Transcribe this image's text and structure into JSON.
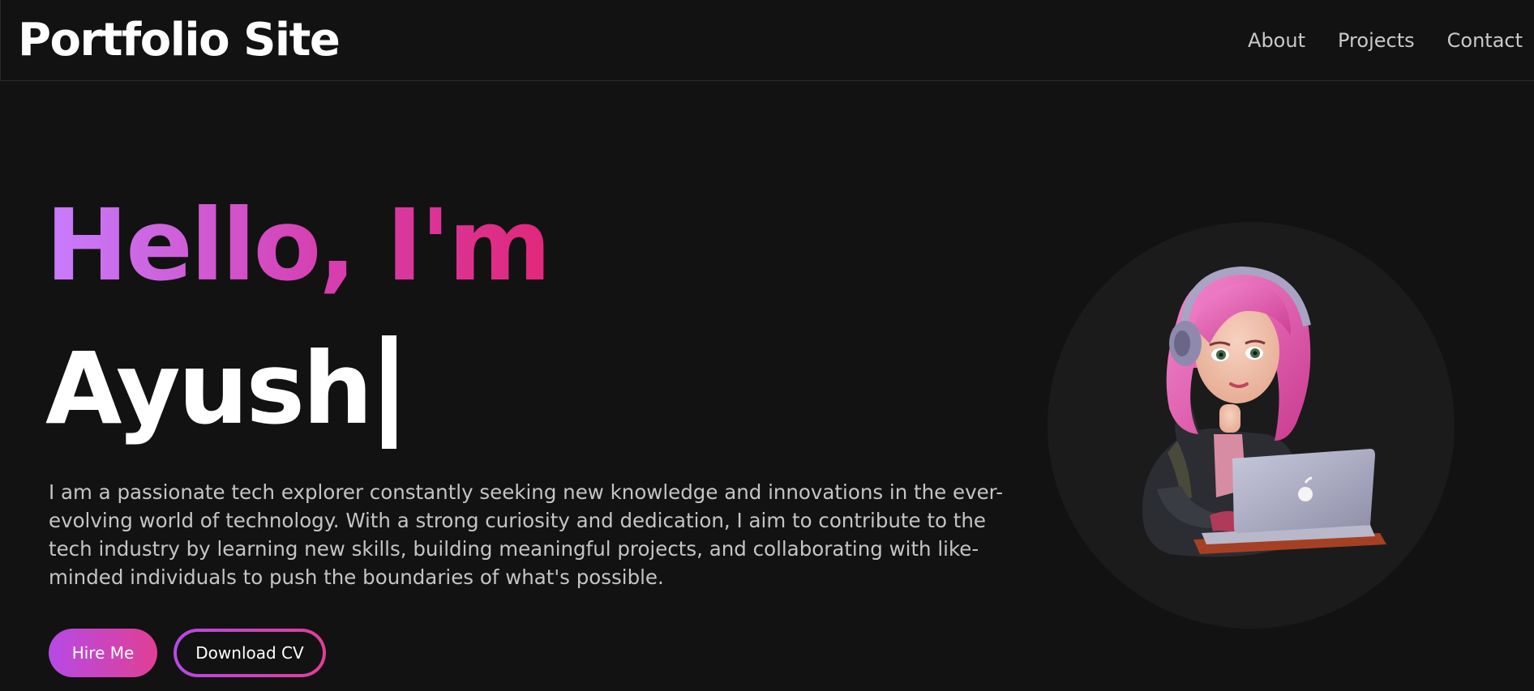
{
  "header": {
    "logo_text": "Portfolio Site",
    "nav": [
      {
        "label": "About"
      },
      {
        "label": "Projects"
      },
      {
        "label": "Contact"
      }
    ]
  },
  "hero": {
    "greeting": "Hello, I'm",
    "name": "Ayush",
    "bio": "I am a passionate tech explorer constantly seeking new knowledge and innovations in the ever-evolving world of technology. With a strong curiosity and dedication, I aim to contribute to the tech industry by learning new skills, building meaningful projects, and collaborating with like-minded individuals to push the boundaries of what's possible.",
    "primary_button": "Hire Me",
    "secondary_button": "Download CV"
  },
  "avatar": {
    "icon": "avatar-illustration"
  },
  "colors": {
    "background": "#121212",
    "accent_start": "#c77dff",
    "accent_end": "#e0287a",
    "text_muted": "#c4c4c4"
  }
}
